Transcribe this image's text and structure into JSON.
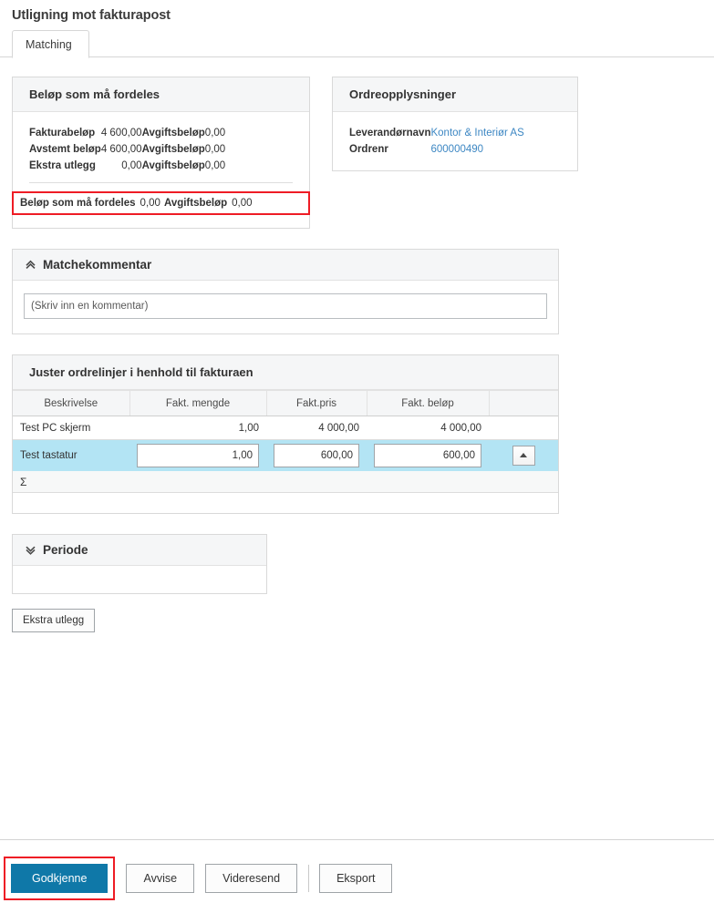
{
  "page": {
    "title": "Utligning mot fakturapost"
  },
  "tabs": [
    {
      "label": "Matching",
      "active": true
    }
  ],
  "amounts_panel": {
    "title": "Beløp som må fordeles",
    "rows": [
      {
        "label": "Fakturabeløp",
        "value": "4 600,00",
        "tax_label": "Avgiftsbeløp",
        "tax_value": "0,00"
      },
      {
        "label": "Avstemt beløp",
        "value": "4 600,00",
        "tax_label": "Avgiftsbeløp",
        "tax_value": "0,00"
      },
      {
        "label": "Ekstra utlegg",
        "value": "0,00",
        "tax_label": "Avgiftsbeløp",
        "tax_value": "0,00"
      }
    ],
    "total": {
      "label": "Beløp som må fordeles",
      "value": "0,00",
      "tax_label": "Avgiftsbeløp",
      "tax_value": "0,00"
    },
    "highlight_color": "#ee1c25"
  },
  "order_panel": {
    "title": "Ordreopplysninger",
    "rows": [
      {
        "label": "Leverandørnavn",
        "value": "Kontor & Interiør AS"
      },
      {
        "label": "Ordrenr",
        "value": "600000490"
      }
    ],
    "link_color": "#3d87c3"
  },
  "comment_panel": {
    "title": "Matchekommentar",
    "chevron": "chevron-double-up-icon",
    "input_value": "",
    "input_placeholder": "(Skriv inn en kommentar)"
  },
  "lines_panel": {
    "title": "Juster ordrelinjer i henhold til fakturaen",
    "columns": [
      "Beskrivelse",
      "Fakt. mengde",
      "Fakt.pris",
      "Fakt. beløp",
      ""
    ],
    "rows": [
      {
        "description": "Test PC skjerm",
        "quantity": "1,00",
        "price": "4 000,00",
        "amount": "4 000,00",
        "editable": false,
        "selected": false
      },
      {
        "description": "Test tastatur",
        "quantity": "1,00",
        "price": "600,00",
        "amount": "600,00",
        "editable": true,
        "selected": true
      }
    ],
    "sum_symbol": "Σ",
    "selected_row_color": "#b3e4f4"
  },
  "period_panel": {
    "title": "Periode",
    "chevron": "chevron-double-down-icon"
  },
  "extra_button": {
    "label": "Ekstra utlegg"
  },
  "footer": {
    "primary": {
      "label": "Godkjenne",
      "color": "#0f78a8",
      "highlight_color": "#ee1c25"
    },
    "buttons": [
      {
        "label": "Avvise"
      },
      {
        "label": "Videresend"
      }
    ],
    "export": {
      "label": "Eksport"
    }
  }
}
